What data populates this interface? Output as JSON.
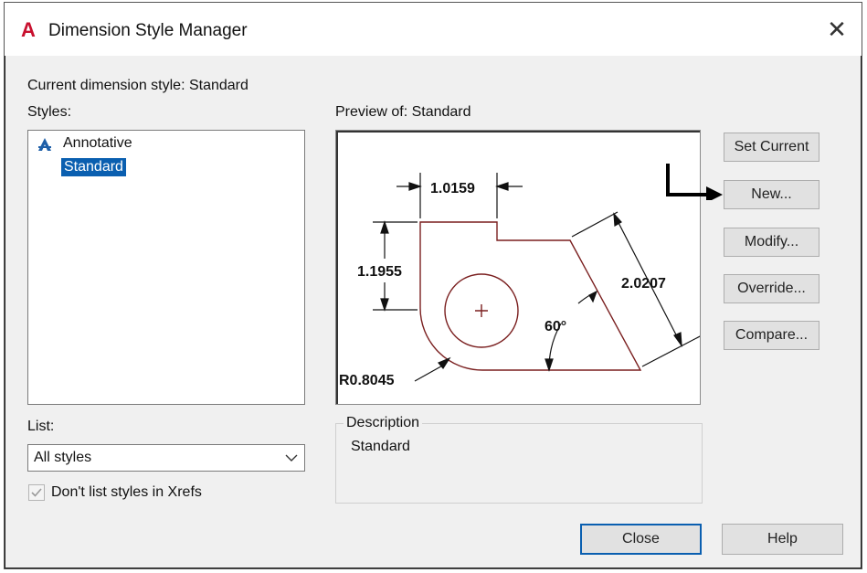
{
  "window": {
    "title": "Dimension Style Manager",
    "logo_letter": "A"
  },
  "current_style_label": "Current dimension style: Standard",
  "styles": {
    "label": "Styles:",
    "items": [
      {
        "label": "Annotative",
        "icon": "annotative-icon"
      },
      {
        "label": "Standard",
        "selected": true
      }
    ]
  },
  "preview": {
    "label": "Preview of: Standard",
    "dimensions": {
      "horizontal": "1.0159",
      "vertical": "1.1955",
      "aligned": "2.0207",
      "angle": "60°",
      "radius": "R0.8045"
    }
  },
  "buttons": {
    "set_current": "Set Current",
    "new": "New...",
    "modify": "Modify...",
    "override": "Override...",
    "compare": "Compare...",
    "close": "Close",
    "help": "Help"
  },
  "description": {
    "legend": "Description",
    "text": "Standard"
  },
  "list": {
    "label": "List:",
    "value": "All styles"
  },
  "xref_checkbox": {
    "label": "Don't list styles in Xrefs",
    "checked": true
  },
  "colors": {
    "accent": "#0a5fb0",
    "logo": "#c8102e",
    "geometry": "#7a1f1f"
  }
}
